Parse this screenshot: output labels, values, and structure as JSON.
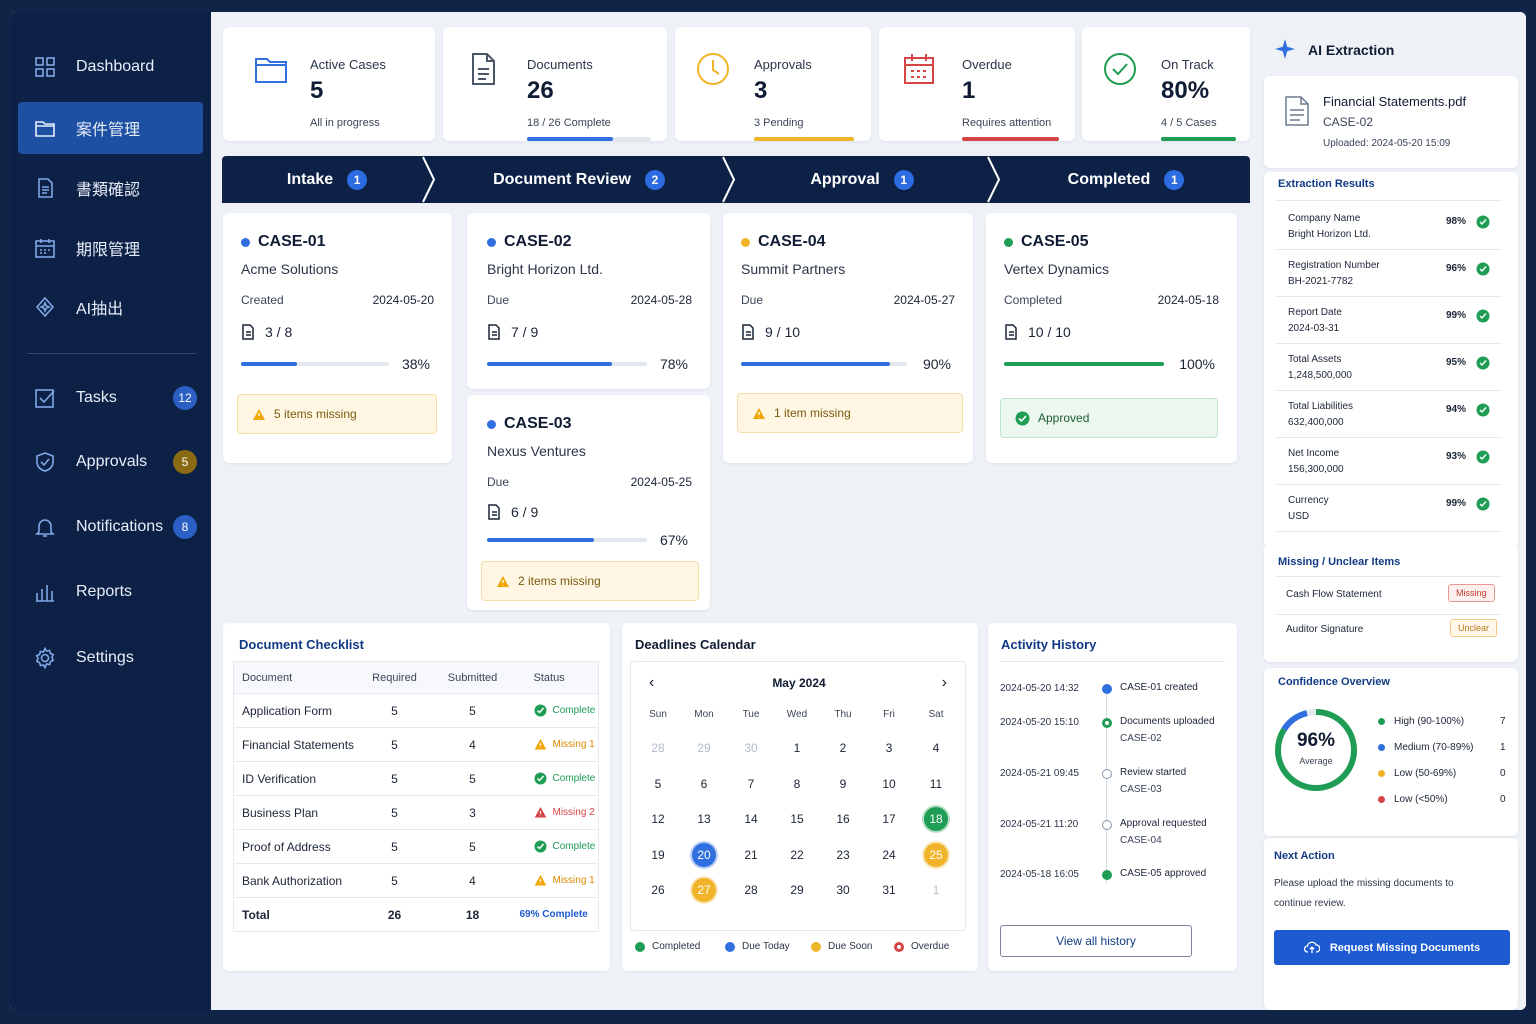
{
  "sidebar": {
    "items": [
      {
        "label": "Dashboard",
        "icon": "grid-icon"
      },
      {
        "label": "案件管理",
        "icon": "folder-icon"
      },
      {
        "label": "書類確認",
        "icon": "document-icon"
      },
      {
        "label": "期限管理",
        "icon": "calendar-icon"
      },
      {
        "label": "AI抽出",
        "icon": "ai-icon"
      }
    ],
    "items2": [
      {
        "label": "Tasks",
        "icon": "checkbox-icon",
        "badge": "12"
      },
      {
        "label": "Approvals",
        "icon": "shield-check-icon",
        "badge": "5"
      },
      {
        "label": "Notifications",
        "icon": "bell-icon",
        "badge": "8"
      },
      {
        "label": "Reports",
        "icon": "bar-chart-icon"
      },
      {
        "label": "Settings",
        "icon": "gear-icon"
      }
    ]
  },
  "stats": [
    {
      "title": "Active Cases",
      "value": "5",
      "sub": "All in progress",
      "icon": "folder-icon",
      "color": "#2f6fdf"
    },
    {
      "title": "Documents",
      "value": "26",
      "sub": "18 / 26 Complete",
      "icon": "document-icon",
      "color": "#2f6fdf",
      "progress": 0.69
    },
    {
      "title": "Approvals",
      "value": "3",
      "sub": "3 Pending",
      "icon": "clock-icon",
      "color": "#f0b429",
      "progress": 1.0
    },
    {
      "title": "Overdue",
      "value": "1",
      "sub": "Requires attention",
      "icon": "calendar-alert-icon",
      "color": "#d64545",
      "progress": 1.0
    },
    {
      "title": "On Track",
      "value": "80%",
      "sub": "4 / 5 Cases",
      "icon": "check-circle-icon",
      "color": "#1f9d55",
      "progress": 1.0
    }
  ],
  "pipeline": [
    {
      "label": "Intake",
      "count": "1"
    },
    {
      "label": "Document Review",
      "count": "2"
    },
    {
      "label": "Approval",
      "count": "1"
    },
    {
      "label": "Completed",
      "count": "1"
    }
  ],
  "cases": {
    "c1": {
      "id": "CASE-01",
      "company": "Acme Solutions",
      "date_label": "Created",
      "date": "2024-05-20",
      "docs": "3 / 8",
      "pct": "38%",
      "progress": 0.38,
      "alert": "5 items missing",
      "status_color": "#2f6fdf"
    },
    "c2": {
      "id": "CASE-02",
      "company": "Bright Horizon Ltd.",
      "date_label": "Due",
      "date": "2024-05-28",
      "docs": "7 / 9",
      "pct": "78%",
      "progress": 0.78,
      "status_color": "#2f6fdf"
    },
    "c3": {
      "id": "CASE-03",
      "company": "Nexus Ventures",
      "date_label": "Due",
      "date": "2024-05-25",
      "docs": "6 / 9",
      "pct": "67%",
      "progress": 0.67,
      "alert": "2 items missing",
      "status_color": "#2f6fdf"
    },
    "c4": {
      "id": "CASE-04",
      "company": "Summit Partners",
      "date_label": "Due",
      "date": "2024-05-27",
      "docs": "9 / 10",
      "pct": "90%",
      "progress": 0.9,
      "alert": "1 item missing",
      "status_color": "#f0b429"
    },
    "c5": {
      "id": "CASE-05",
      "company": "Vertex Dynamics",
      "date_label": "Completed",
      "date": "2024-05-18",
      "docs": "10 / 10",
      "pct": "100%",
      "progress": 1.0,
      "alert": "Approved",
      "status_color": "#1f9d55"
    }
  },
  "checklist": {
    "title": "Document Checklist",
    "headers": [
      "Document",
      "Required",
      "Submitted",
      "Status"
    ],
    "rows": [
      {
        "doc": "Application Form",
        "req": "5",
        "sub": "5",
        "status": "Complete",
        "kind": "ok"
      },
      {
        "doc": "Financial Statements",
        "req": "5",
        "sub": "4",
        "status": "Missing 1",
        "kind": "warn"
      },
      {
        "doc": "ID Verification",
        "req": "5",
        "sub": "5",
        "status": "Complete",
        "kind": "ok"
      },
      {
        "doc": "Business Plan",
        "req": "5",
        "sub": "3",
        "status": "Missing 2",
        "kind": "bad"
      },
      {
        "doc": "Proof of Address",
        "req": "5",
        "sub": "5",
        "status": "Complete",
        "kind": "ok"
      },
      {
        "doc": "Bank Authorization",
        "req": "5",
        "sub": "4",
        "status": "Missing 1",
        "kind": "warn"
      }
    ],
    "total": {
      "label": "Total",
      "req": "26",
      "sub": "18",
      "status": "69% Complete"
    }
  },
  "calendar": {
    "title": "Deadlines Calendar",
    "month": "May 2024",
    "weekdays": [
      "Sun",
      "Mon",
      "Tue",
      "Wed",
      "Thu",
      "Fri",
      "Sat"
    ],
    "weeks": [
      [
        "28",
        "29",
        "30",
        "1",
        "2",
        "3",
        "4"
      ],
      [
        "5",
        "6",
        "7",
        "8",
        "9",
        "10",
        "11"
      ],
      [
        "12",
        "13",
        "14",
        "15",
        "16",
        "17",
        "18"
      ],
      [
        "19",
        "20",
        "21",
        "22",
        "23",
        "24",
        "25"
      ],
      [
        "26",
        "27",
        "28",
        "29",
        "30",
        "31",
        "1"
      ]
    ],
    "legend": [
      "Completed",
      "Due Today",
      "Due Soon",
      "Overdue"
    ]
  },
  "activity": {
    "title": "Activity History",
    "items": [
      {
        "date": "2024-05-20 14:32",
        "text": "CASE-01 created",
        "sub": ""
      },
      {
        "date": "2024-05-20 15:10",
        "text": "Documents uploaded",
        "sub": "CASE-02"
      },
      {
        "date": "2024-05-21 09:45",
        "text": "Review started",
        "sub": "CASE-03"
      },
      {
        "date": "2024-05-21 11:20",
        "text": "Approval requested",
        "sub": "CASE-04"
      },
      {
        "date": "2024-05-18 16:05",
        "text": "CASE-05 approved",
        "sub": ""
      }
    ],
    "button": "View all history"
  },
  "ai": {
    "title": "AI Extraction",
    "file": "Financial Statements.pdf",
    "case": "CASE-02",
    "uploaded": "Uploaded: 2024-05-20 15:09",
    "results_title": "Extraction Results",
    "fields": [
      {
        "k": "Company Name",
        "v": "Bright Horizon Ltd.",
        "c": "98%"
      },
      {
        "k": "Registration Number",
        "v": "BH-2021-7782",
        "c": "96%"
      },
      {
        "k": "Report Date",
        "v": "2024-03-31",
        "c": "99%"
      },
      {
        "k": "Total Assets",
        "v": "1,248,500,000",
        "c": "95%"
      },
      {
        "k": "Total Liabilities",
        "v": "632,400,000",
        "c": "94%"
      },
      {
        "k": "Net Income",
        "v": "156,300,000",
        "c": "93%"
      },
      {
        "k": "Currency",
        "v": "USD",
        "c": "99%"
      }
    ],
    "missing_title": "Missing / Unclear Items",
    "missing": [
      {
        "k": "Cash Flow Statement",
        "tag": "Missing"
      },
      {
        "k": "Auditor Signature",
        "tag": "Unclear"
      }
    ],
    "conf_title": "Confidence Overview",
    "conf_value": "96%",
    "conf_label": "Average",
    "conf_fraction": 0.96,
    "conf_levels": [
      {
        "k": "High (90-100%)",
        "n": "7",
        "color": "#1f9d55"
      },
      {
        "k": "Medium (70-89%)",
        "n": "1",
        "color": "#2f6fdf"
      },
      {
        "k": "Low (50-69%)",
        "n": "0",
        "color": "#f0b429"
      },
      {
        "k": "Low (<50%)",
        "n": "0",
        "color": "#d64545"
      }
    ],
    "next_title": "Next Action",
    "next_text_1": "Please upload the missing documents to",
    "next_text_2": "continue review.",
    "next_button": "Request Missing Documents"
  }
}
